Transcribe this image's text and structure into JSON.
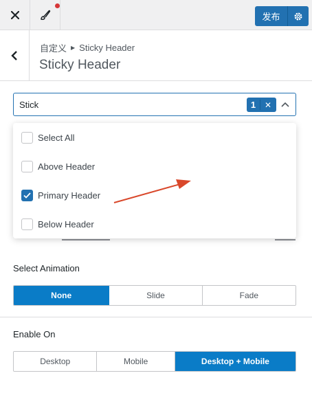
{
  "topbar": {
    "close_icon": "close-icon",
    "brush_icon": "brush-icon",
    "publish_label": "发布",
    "settings_icon": "gear-icon"
  },
  "section": {
    "breadcrumb_parent": "自定义",
    "breadcrumb_current": "Sticky Header",
    "title": "Sticky Header"
  },
  "select": {
    "value": "Stick",
    "selected_count": "1"
  },
  "dropdown": {
    "options": [
      {
        "label": "Select All",
        "checked": false
      },
      {
        "label": "Above Header",
        "checked": false
      },
      {
        "label": "Primary Header",
        "checked": true
      },
      {
        "label": "Below Header",
        "checked": false
      }
    ]
  },
  "animation": {
    "label": "Select Animation",
    "options": [
      "None",
      "Slide",
      "Fade"
    ],
    "selected": "None"
  },
  "enable_on": {
    "label": "Enable On",
    "options": [
      "Desktop",
      "Mobile",
      "Desktop + Mobile"
    ],
    "selected": "Desktop + Mobile"
  },
  "colors": {
    "accent": "#2271b1",
    "active_segment": "#0a7cc7",
    "annotation_arrow": "#d9482b"
  }
}
